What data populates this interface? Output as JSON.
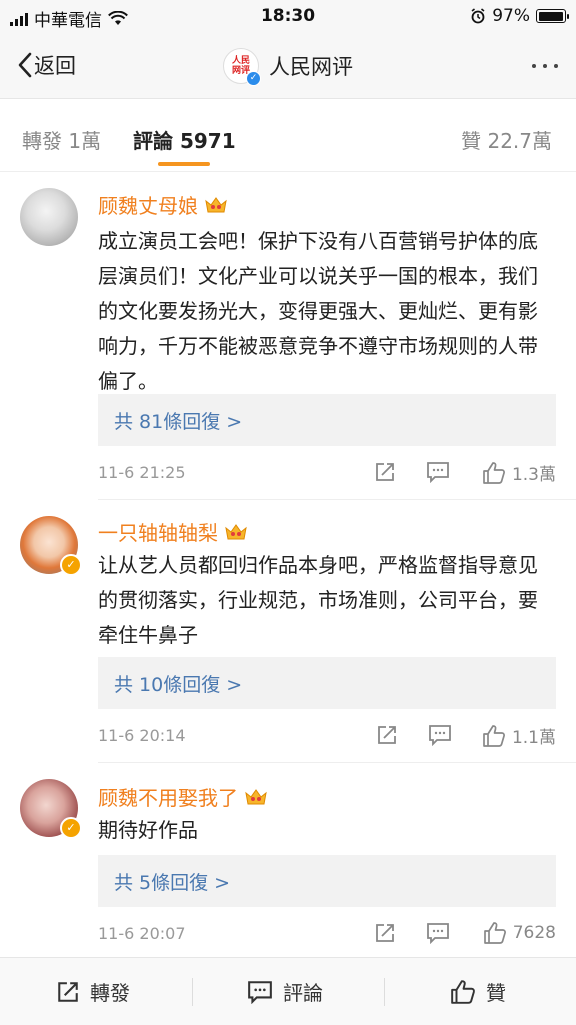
{
  "status_bar": {
    "carrier": "中華電信",
    "time": "18:30",
    "battery": "97%"
  },
  "nav": {
    "back_label": "返回",
    "title": "人民网评",
    "logo_text": "人民网评"
  },
  "tabs": {
    "repost": "轉發 1萬",
    "comment": "評論 5971",
    "like": "贊 22.7萬"
  },
  "comments": [
    {
      "username": "顾魏丈母娘",
      "text": "成立演员工会吧！保护下没有八百营销号护体的底层演员们！文化产业可以说关乎一国的根本，我们的文化要发扬光大，变得更强大、更灿烂、更有影响力，千万不能被恶意竞争不遵守市场规则的人带偏了。",
      "replies": "共 81條回復 >",
      "time": "11-6 21:25",
      "likes": "1.3萬"
    },
    {
      "username": "一只轴轴轴梨",
      "text": "让从艺人员都回归作品本身吧，严格监督指导意见的贯彻落实，行业规范，市场准则，公司平台，要牵住牛鼻子",
      "replies": "共 10條回復 >",
      "time": "11-6 20:14",
      "likes": "1.1萬"
    },
    {
      "username": "顾魏不用娶我了",
      "text": "期待好作品",
      "replies": "共 5條回復 >",
      "time": "11-6 20:07",
      "likes": "7628"
    }
  ],
  "bottom_bar": {
    "repost": "轉發",
    "comment": "評論",
    "like": "贊"
  },
  "colors": {
    "accent": "#f5951f",
    "username": "#f0801f",
    "link": "#4a78b0",
    "verified": "#f5a300"
  }
}
